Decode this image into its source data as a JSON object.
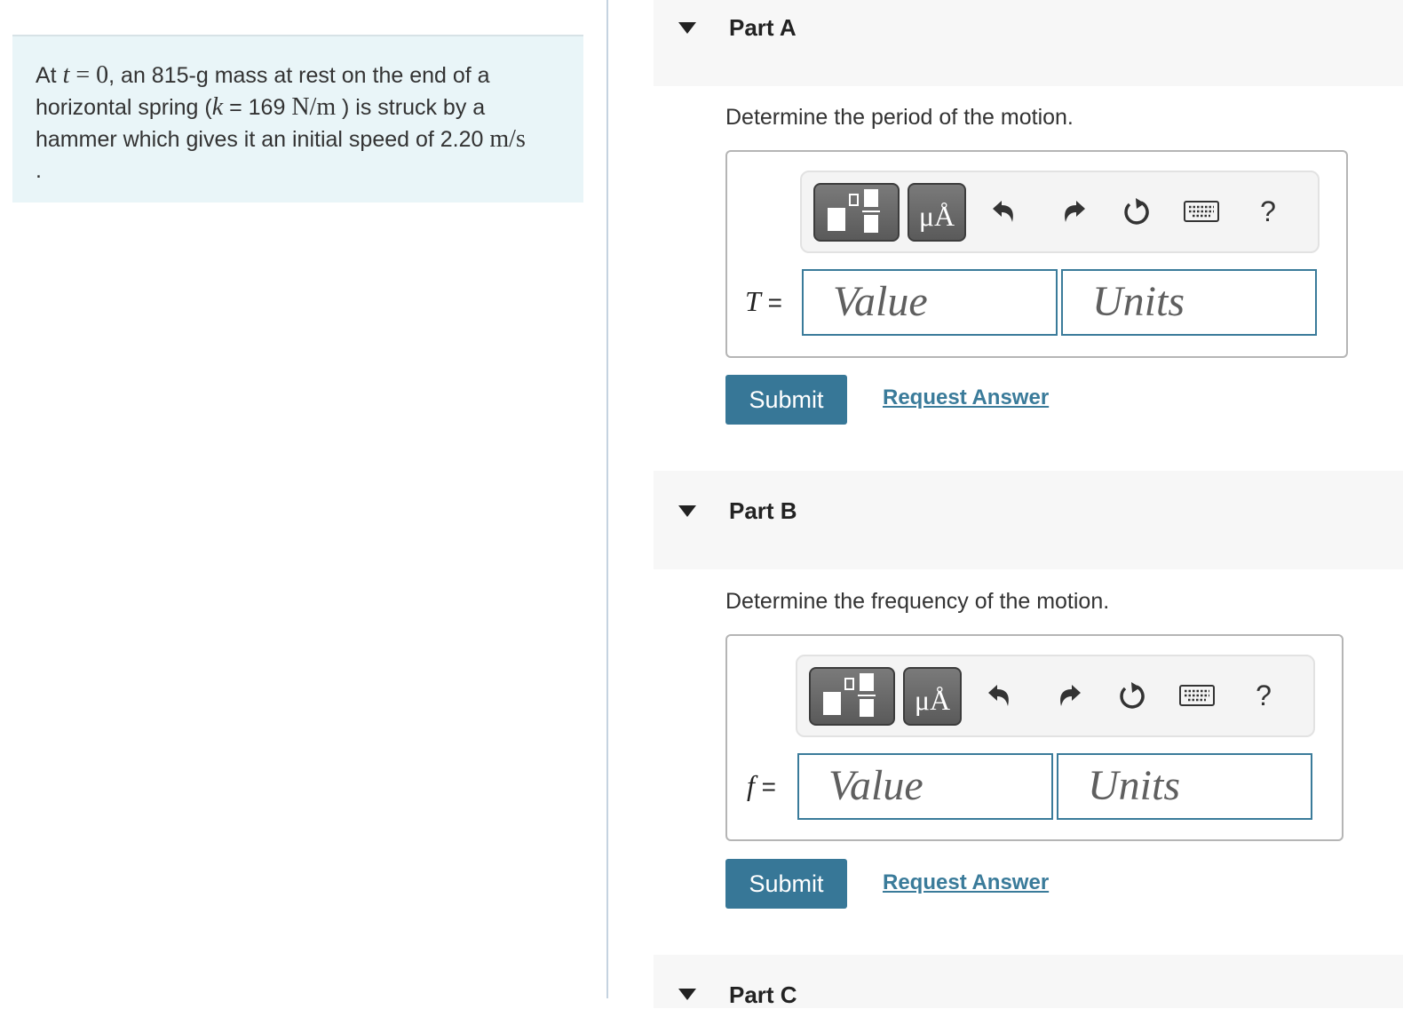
{
  "problem": {
    "text_at": "At ",
    "t_var": "t",
    "eq_zero": " = 0",
    "text1": ", an 815-g mass at rest on the end of a horizontal spring (",
    "k_var": "k",
    "text2": " = 169 ",
    "unit1": "N/m",
    "text3": " ) is struck by a hammer which gives it an initial speed of 2.20 ",
    "unit2": "m/s",
    "text4": "."
  },
  "parts": [
    {
      "title": "Part A",
      "prompt": "Determine the period of the motion.",
      "variable": "T",
      "equals": "=",
      "value_placeholder": "Value",
      "units_placeholder": "Units",
      "submit_label": "Submit",
      "request_label": "Request Answer"
    },
    {
      "title": "Part B",
      "prompt": "Determine the frequency of the motion.",
      "variable": "f",
      "equals": "=",
      "value_placeholder": "Value",
      "units_placeholder": "Units",
      "submit_label": "Submit",
      "request_label": "Request Answer"
    },
    {
      "title": "Part C"
    }
  ],
  "toolbar": {
    "units_symbol": "μÅ",
    "help_label": "?",
    "icons": [
      "templates-icon",
      "units-icon",
      "undo-icon",
      "redo-icon",
      "reset-icon",
      "keyboard-icon",
      "help-icon"
    ]
  },
  "colors": {
    "accent": "#377797",
    "field_border": "#3a7b9a",
    "problem_bg": "#e9f5f8",
    "header_bg": "#f7f7f7"
  }
}
